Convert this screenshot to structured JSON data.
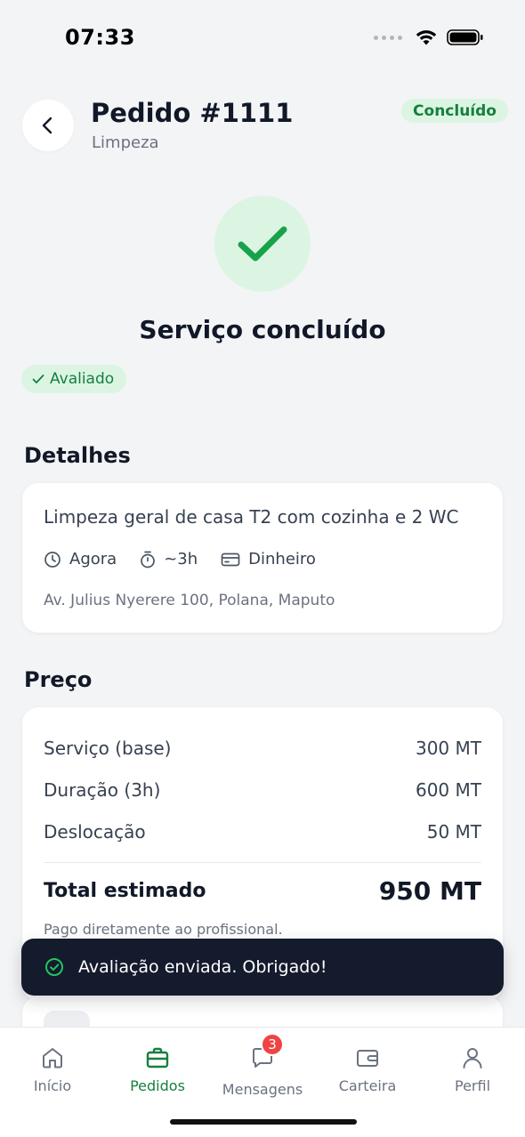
{
  "status_bar": {
    "time": "07:33"
  },
  "header": {
    "title": "Pedido #1111",
    "subtitle": "Limpeza",
    "status": "Concluído"
  },
  "completion": {
    "title": "Serviço concluído",
    "rated_label": "Avaliado"
  },
  "details": {
    "section_title": "Detalhes",
    "description": "Limpeza geral de casa T2 com cozinha e 2 WC",
    "when": "Agora",
    "duration": "~3h",
    "payment": "Dinheiro",
    "address": "Av. Julius Nyerere 100, Polana, Maputo"
  },
  "price": {
    "section_title": "Preço",
    "rows": [
      {
        "label": "Serviço (base)",
        "value": "300 MT"
      },
      {
        "label": "Duração (3h)",
        "value": "600 MT"
      },
      {
        "label": "Deslocação",
        "value": "50 MT"
      }
    ],
    "total_label": "Total estimado",
    "total_value": "950 MT",
    "note": "Pago diretamente ao profissional."
  },
  "toast": {
    "message": "Avaliação enviada. Obrigado!"
  },
  "tabs": [
    {
      "label": "Início",
      "icon": "home-icon"
    },
    {
      "label": "Pedidos",
      "icon": "briefcase-icon",
      "active": true
    },
    {
      "label": "Mensagens",
      "icon": "chat-icon",
      "badge": "3"
    },
    {
      "label": "Carteira",
      "icon": "wallet-icon"
    },
    {
      "label": "Perfil",
      "icon": "user-icon"
    }
  ],
  "colors": {
    "accent": "#15803d",
    "accent_bg": "#dcf5e3",
    "toast_bg": "#141b2d",
    "badge": "#ef4444"
  }
}
